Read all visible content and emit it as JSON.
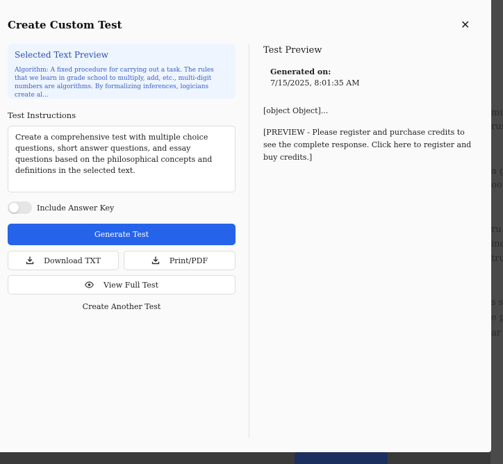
{
  "background": {
    "fragments": [
      "mu",
      "rus",
      "a g",
      "oo",
      "ru",
      "inc",
      "tru",
      "s s",
      "e p",
      "ar"
    ]
  },
  "modal": {
    "title": "Create Custom Test",
    "close_label": "✕"
  },
  "selected_preview": {
    "title": "Selected Text Preview",
    "text": "Algorithm: A fixed procedure for carrying out a task. The rules that we learn in grade school to multiply, add, etc., multi-digit numbers are algorithms. By formalizing inferences, logicians create al..."
  },
  "instructions": {
    "label": "Test Instructions",
    "value": "Create a comprehensive test with multiple choice questions, short answer questions, and essay questions based on the philosophical concepts and definitions in the selected text."
  },
  "answer_key": {
    "label": "Include Answer Key",
    "enabled": false
  },
  "buttons": {
    "generate": "Generate Test",
    "download": "Download TXT",
    "print": "Print/PDF",
    "view_full": "View Full Test",
    "create_another": "Create Another Test"
  },
  "test_preview": {
    "title": "Test Preview",
    "generated_label": "Generated on:",
    "generated_value": "7/15/2025, 8:01:35 AM",
    "content": "[object Object]...",
    "notice": "[PREVIEW - Please register and purchase credits to see the complete response. Click here to register and buy credits.]"
  },
  "colors": {
    "primary": "#2563eb",
    "preview_bg": "#eef5ff",
    "preview_text": "#3a5fc4"
  },
  "icons": [
    "download-icon",
    "eye-icon",
    "close-icon"
  ]
}
